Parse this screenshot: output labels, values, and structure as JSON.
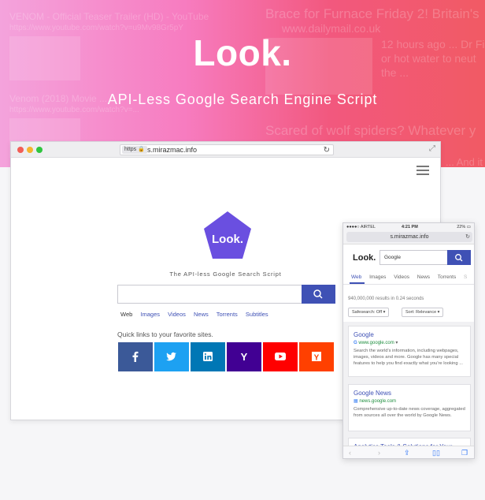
{
  "hero": {
    "logo": "Look.",
    "subtitle": "API-Less Google Search Engine Script",
    "background_results": [
      "VENOM - Official Teaser Trailer (HD) - YouTube",
      "https://www.youtube.com/watch?v=u9Mv98Gr5pY",
      "Venom (2018) Movie ...",
      "https://www.youtube.com/watch?v=...",
      "Brace for Furnace Friday 2! Britain's",
      "www.dailymail.co.uk",
      "12 hours ago ... Dr Fi",
      "or hot water to neut",
      "the ...",
      "Scared of wolf spiders? Whatever y",
      "... And it"
    ]
  },
  "desktop": {
    "url_badge": "https",
    "url": "s.mirazmac.info",
    "logo": "Look.",
    "tagline": "The API-less Google Search Script",
    "tabs": [
      "Web",
      "Images",
      "Videos",
      "News",
      "Torrents",
      "Subtitles"
    ],
    "quick_links_title": "Quick links to your favorite sites.",
    "quick_links": [
      {
        "name": "facebook",
        "label": "f",
        "color": "#3b5998"
      },
      {
        "name": "twitter",
        "label": "t",
        "color": "#1da1f2"
      },
      {
        "name": "linkedin",
        "label": "in",
        "color": "#0077b5"
      },
      {
        "name": "yahoo",
        "label": "Y",
        "color": "#410093"
      },
      {
        "name": "youtube",
        "label": "▶",
        "color": "#ff0000"
      },
      {
        "name": "ycombinator",
        "label": "Y",
        "color": "#ff4000"
      }
    ],
    "accent": "#3f51b5",
    "logo_color": "#6a4fe0"
  },
  "phone": {
    "carrier": "●●●●○ AIRTEL",
    "time": "4:21 PM",
    "battery": "22%",
    "url": "s.mirazmac.info",
    "logo": "Look.",
    "query": "Google",
    "tabs": [
      "Web",
      "Images",
      "Videos",
      "News",
      "Torrents",
      "S"
    ],
    "result_count": "940,000,000 results in 0.24 seconds",
    "safesearch": "Safesearch: Off",
    "sort": "Sort: Relevance",
    "results": [
      {
        "title": "Google",
        "url": "www.google.com",
        "description": "Search the world's information, including webpages, images, videos and more. Google has many special features to help you find exactly what you're looking ..."
      },
      {
        "title": "Google News",
        "url": "news.google.com",
        "description": "Comprehensive up-to-date news coverage, aggregated from sources all over the world by Google News."
      },
      {
        "title": "Analytics Tools & Solutions for Your",
        "url": "",
        "description": ""
      }
    ]
  }
}
